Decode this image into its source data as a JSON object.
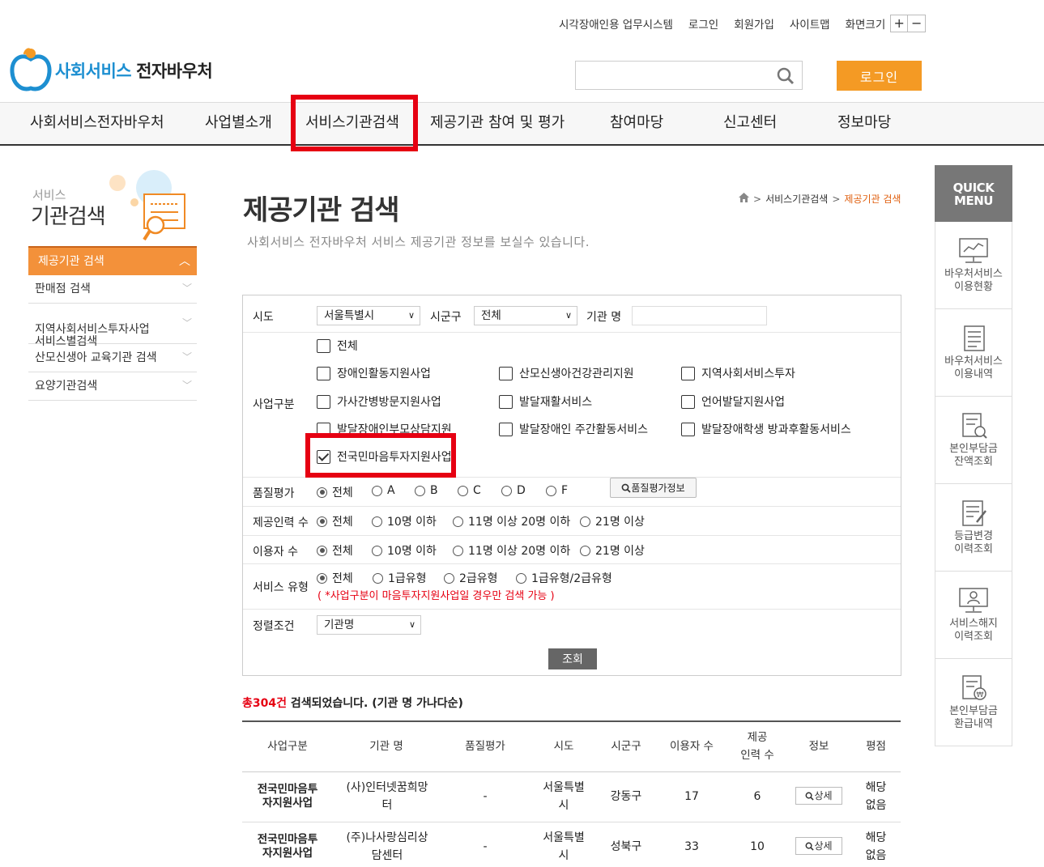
{
  "util": {
    "links": [
      "시각장애인용 업무시스템",
      "로그인",
      "회원가입",
      "사이트맵"
    ],
    "zoom_label": "화면크기",
    "zoom_in": "+",
    "zoom_out": "−"
  },
  "logo": {
    "part1": "사회서비스",
    "part2": "전자바우처"
  },
  "header": {
    "login_button": "로그인",
    "search_placeholder": ""
  },
  "gnb": [
    "사회서비스전자바우처",
    "사업별소개",
    "서비스기관검색",
    "제공기관 참여 및 평가",
    "참여마당",
    "신고센터",
    "정보마당"
  ],
  "lnb": {
    "title_small": "서비스",
    "title_big": "기관검색",
    "active": "제공기관 검색",
    "items": [
      "판매점 검색",
      "지역사회서비스투자사업\n서비스별검색",
      "산모신생아 교육기관 검색",
      "요양기관검색"
    ]
  },
  "page": {
    "title": "제공기관 검색",
    "desc": "사회서비스 전자바우처 서비스 제공기관 정보를 보실수 있습니다.",
    "breadcrumb": [
      "서비스기관검색",
      "제공기관 검색"
    ]
  },
  "form": {
    "sido_label": "시도",
    "sido_value": "서울특별시",
    "sigungu_label": "시군구",
    "sigungu_value": "전체",
    "name_label": "기관 명",
    "biz_label": "사업구분",
    "biz_items": [
      {
        "label": "전체",
        "checked": false
      },
      {
        "label": "장애인활동지원사업",
        "checked": false
      },
      {
        "label": "산모신생아건강관리지원",
        "checked": false
      },
      {
        "label": "지역사회서비스투자",
        "checked": false
      },
      {
        "label": "가사간병방문지원사업",
        "checked": false
      },
      {
        "label": "발달재활서비스",
        "checked": false
      },
      {
        "label": "언어발달지원사업",
        "checked": false
      },
      {
        "label": "발달장애인부모상담지원",
        "checked": false
      },
      {
        "label": "발달장애인 주간활동서비스",
        "checked": false
      },
      {
        "label": "발달장애학생 방과후활동서비스",
        "checked": false
      },
      {
        "label": "전국민마음투자지원사업",
        "checked": true
      }
    ],
    "quality_label": "품질평가",
    "quality_options": [
      "전체",
      "A",
      "B",
      "C",
      "D",
      "F"
    ],
    "quality_button": "품질평가정보",
    "staff_label": "제공인력 수",
    "staff_options": [
      "전체",
      "10명 이하",
      "11명 이상 20명 이하",
      "21명 이상"
    ],
    "users_label": "이용자 수",
    "users_options": [
      "전체",
      "10명 이하",
      "11명 이상 20명 이하",
      "21명 이상"
    ],
    "service_label": "서비스 유형",
    "service_options": [
      "전체",
      "1급유형",
      "2급유형",
      "1급유형/2급유형"
    ],
    "service_note": "( *사업구분이 마음투자지원사업일 경우만 검색 가능 )",
    "sort_label": "정렬조건",
    "sort_value": "기관명",
    "search_button": "조회"
  },
  "result": {
    "count": "총304건",
    "suffix": " 검색되었습니다. (기관 명 가나다순)",
    "headers": [
      "사업구분",
      "기관 명",
      "품질평가",
      "시도",
      "시군구",
      "이용자 수",
      "제공\n인력 수",
      "정보",
      "평점"
    ],
    "rows": [
      {
        "biz": "전국민마음투\n자지원사업",
        "name": "(사)인터넷꿈희망\n터",
        "quality": "-",
        "sido": "서울특별\n시",
        "sigungu": "강동구",
        "users": "17",
        "staff": "6",
        "info": "상세",
        "rating": "해당\n없음"
      },
      {
        "biz": "전국민마음투\n자지원사업",
        "name": "(주)나사랑심리상\n담센터",
        "quality": "-",
        "sido": "서울특별\n시",
        "sigungu": "성북구",
        "users": "33",
        "staff": "10",
        "info": "상세",
        "rating": "해당\n없음"
      }
    ]
  },
  "quick": {
    "title": "QUICK\nMENU",
    "items": [
      "바우처서비스\n이용현황",
      "바우처서비스\n이용내역",
      "본인부담금\n잔액조회",
      "등급변경\n이력조회",
      "서비스해지\n이력조회",
      "본인부담금\n환급내역"
    ]
  },
  "colors": {
    "accent": "#f49a24",
    "highlight": "#e60012",
    "logo_blue": "#1d8fd1"
  }
}
